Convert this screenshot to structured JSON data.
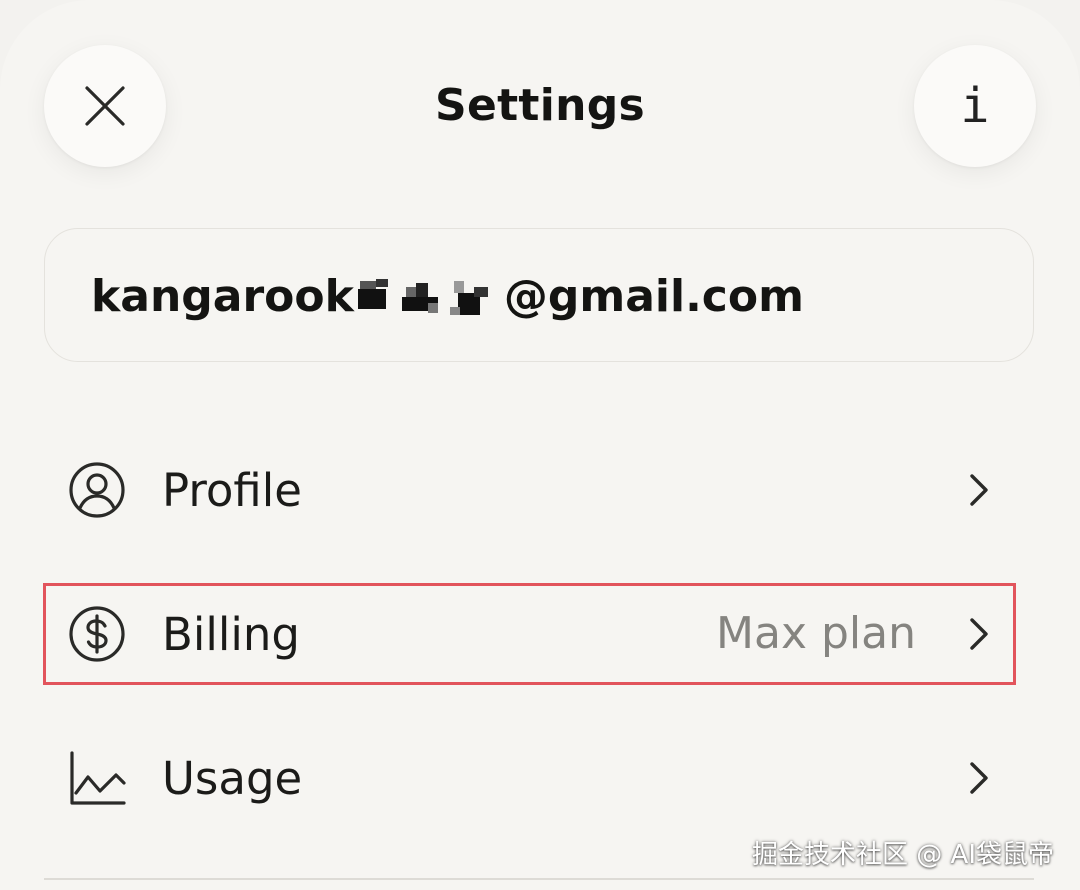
{
  "header": {
    "title": "Settings",
    "close_icon": "close-icon",
    "info_icon": "info-icon",
    "info_glyph": "i"
  },
  "account": {
    "email_prefix": "kangarook",
    "email_suffix": "@gmail.com"
  },
  "menu": {
    "items": [
      {
        "label": "Profile",
        "icon": "user-circle-icon",
        "value": ""
      },
      {
        "label": "Billing",
        "icon": "dollar-circle-icon",
        "value": "Max plan"
      },
      {
        "label": "Usage",
        "icon": "line-chart-icon",
        "value": ""
      }
    ]
  },
  "colors": {
    "background": "#f6f5f2",
    "highlight": "#e2545c",
    "value_text": "#858480"
  },
  "watermark": "掘金技术社区 @ AI袋鼠帝"
}
